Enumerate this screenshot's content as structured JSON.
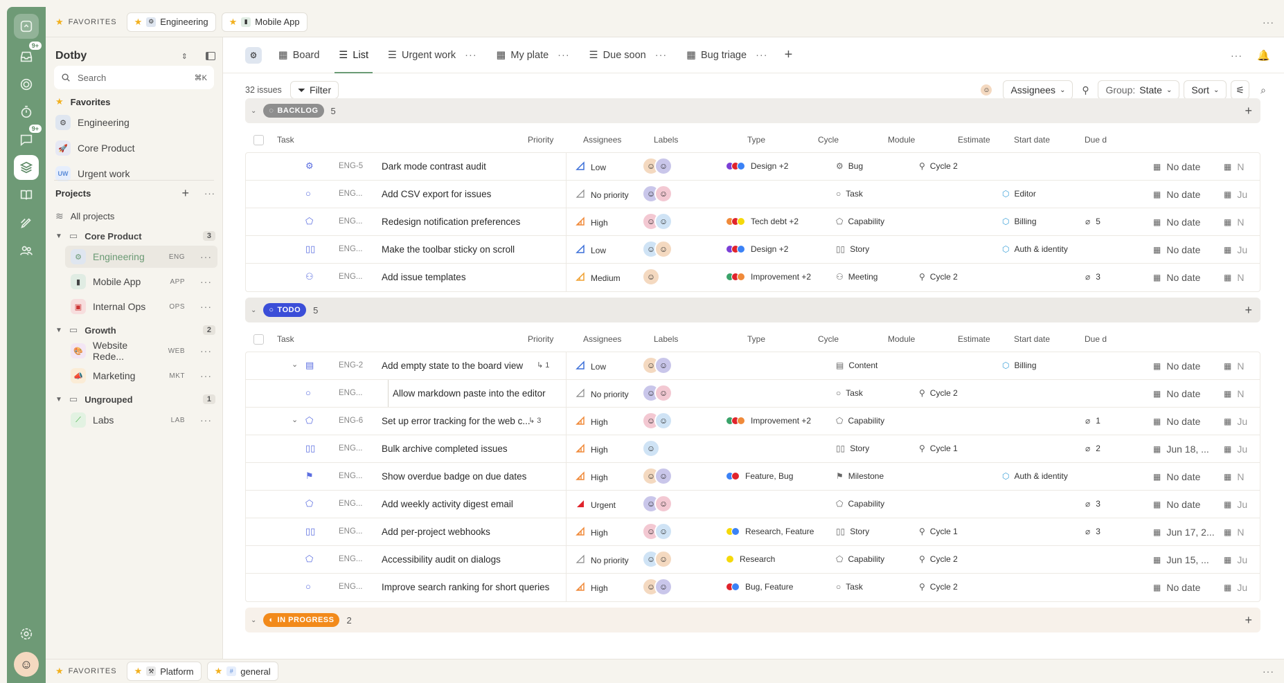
{
  "colors": {
    "accent": "#6a9a74",
    "rail": "#6e9a76",
    "backlog": "#8e8e8e",
    "todo": "#3b4ed8",
    "inprogress": "#f28a1b",
    "urgent": "#e0242c",
    "high": "#f08a3a"
  },
  "rail": {
    "badges": [
      "9+",
      "9+"
    ]
  },
  "topbar": {
    "favorites_label": "FAVORITES",
    "chips": [
      {
        "label": "Engineering",
        "icon": "gear-icon"
      },
      {
        "label": "Mobile App",
        "icon": "phone-icon"
      }
    ],
    "more": "···"
  },
  "bottombar": {
    "favorites_label": "FAVORITES",
    "chips": [
      {
        "label": "Platform",
        "icon": "tools-icon"
      },
      {
        "label": "general",
        "icon": "hash-icon"
      }
    ],
    "more": "···"
  },
  "sidebar": {
    "workspace": "Dotby",
    "search": {
      "placeholder": "Search",
      "shortcut": "⌘K"
    },
    "favorites_title": "Favorites",
    "favorites": [
      {
        "label": "Engineering"
      },
      {
        "label": "Core Product"
      },
      {
        "label": "Urgent work",
        "badge": "UW"
      }
    ],
    "projects_title": "Projects",
    "all_projects": "All projects",
    "groups": [
      {
        "label": "Core Product",
        "count": "3",
        "items": [
          {
            "label": "Engineering",
            "code": "ENG"
          },
          {
            "label": "Mobile App",
            "code": "APP"
          },
          {
            "label": "Internal Ops",
            "code": "OPS"
          }
        ]
      },
      {
        "label": "Growth",
        "count": "2",
        "items": [
          {
            "label": "Website Rede...",
            "code": "WEB"
          },
          {
            "label": "Marketing",
            "code": "MKT"
          }
        ]
      },
      {
        "label": "Ungrouped",
        "count": "1",
        "items": [
          {
            "label": "Labs",
            "code": "LAB"
          }
        ]
      }
    ]
  },
  "viewtabs": [
    {
      "label": "Board"
    },
    {
      "label": "List"
    },
    {
      "label": "Urgent work"
    },
    {
      "label": "My plate"
    },
    {
      "label": "Due soon"
    },
    {
      "label": "Bug triage"
    }
  ],
  "toolbar": {
    "count": "32 issues",
    "filter": "Filter",
    "assignees": "Assignees",
    "group_prefix": "Group:",
    "group_value": "State",
    "sort": "Sort"
  },
  "columns": {
    "task": "Task",
    "priority": "Priority",
    "assignees": "Assignees",
    "labels": "Labels",
    "type": "Type",
    "cycle": "Cycle",
    "module": "Module",
    "estimate": "Estimate",
    "start": "Start date",
    "due": "Due d"
  },
  "groups": [
    {
      "state": "BACKLOG",
      "count": "5",
      "rows": [
        {
          "id": "ENG-5",
          "title": "Dark mode contrast audit",
          "priority": "Low",
          "labels": "Design +2",
          "type": "Bug",
          "cycle": "Cycle 2",
          "module": "",
          "estimate": "",
          "start": "No date",
          "due": "N"
        },
        {
          "id": "ENG...",
          "title": "Add CSV export for issues",
          "priority": "No priority",
          "labels": "",
          "type": "Task",
          "cycle": "",
          "module": "Editor",
          "estimate": "",
          "start": "No date",
          "due": "Ju"
        },
        {
          "id": "ENG...",
          "title": "Redesign notification preferences",
          "priority": "High",
          "labels": "Tech debt +2",
          "type": "Capability",
          "cycle": "",
          "module": "Billing",
          "estimate": "5",
          "start": "No date",
          "due": "N"
        },
        {
          "id": "ENG...",
          "title": "Make the toolbar sticky on scroll",
          "priority": "Low",
          "labels": "Design +2",
          "type": "Story",
          "cycle": "",
          "module": "Auth & identity",
          "estimate": "",
          "start": "No date",
          "due": "Ju"
        },
        {
          "id": "ENG...",
          "title": "Add issue templates",
          "priority": "Medium",
          "labels": "Improvement +2",
          "type": "Meeting",
          "cycle": "Cycle 2",
          "module": "",
          "estimate": "3",
          "start": "No date",
          "due": "N"
        }
      ]
    },
    {
      "state": "TODO",
      "count": "5",
      "rows": [
        {
          "id": "ENG-2",
          "title": "Add empty state to the board view",
          "sub": "1",
          "priority": "Low",
          "labels": "",
          "type": "Content",
          "cycle": "",
          "module": "Billing",
          "estimate": "",
          "start": "No date",
          "due": "N"
        },
        {
          "id": "ENG...",
          "title": "Allow markdown paste into the editor",
          "priority": "No priority",
          "labels": "",
          "type": "Task",
          "cycle": "Cycle 2",
          "module": "",
          "estimate": "",
          "start": "No date",
          "due": "N"
        },
        {
          "id": "ENG-6",
          "title": "Set up error tracking for the web c...",
          "sub": "3",
          "priority": "High",
          "labels": "Improvement +2",
          "type": "Capability",
          "cycle": "",
          "module": "",
          "estimate": "1",
          "start": "No date",
          "due": "Ju"
        },
        {
          "id": "ENG...",
          "title": "Bulk archive completed issues",
          "priority": "High",
          "labels": "",
          "type": "Story",
          "cycle": "Cycle 1",
          "module": "",
          "estimate": "2",
          "start": "Jun 18, ...",
          "due": "Ju"
        },
        {
          "id": "ENG...",
          "title": "Show overdue badge on due dates",
          "priority": "High",
          "labels": "Feature, Bug",
          "type": "Milestone",
          "cycle": "",
          "module": "Auth & identity",
          "estimate": "",
          "start": "No date",
          "due": "N"
        },
        {
          "id": "ENG...",
          "title": "Add weekly activity digest email",
          "priority": "Urgent",
          "labels": "",
          "type": "Capability",
          "cycle": "",
          "module": "",
          "estimate": "3",
          "start": "No date",
          "due": "Ju"
        },
        {
          "id": "ENG...",
          "title": "Add per-project webhooks",
          "priority": "High",
          "labels": "Research, Feature",
          "type": "Story",
          "cycle": "Cycle 1",
          "module": "",
          "estimate": "3",
          "start": "Jun 17, 2...",
          "due": "N"
        },
        {
          "id": "ENG...",
          "title": "Accessibility audit on dialogs",
          "priority": "No priority",
          "labels": "Research",
          "type": "Capability",
          "cycle": "Cycle 2",
          "module": "",
          "estimate": "",
          "start": "Jun 15, ...",
          "due": "Ju"
        },
        {
          "id": "ENG...",
          "title": "Improve search ranking for short queries",
          "priority": "High",
          "labels": "Bug, Feature",
          "type": "Task",
          "cycle": "Cycle 2",
          "module": "",
          "estimate": "",
          "start": "No date",
          "due": "Ju"
        }
      ]
    },
    {
      "state": "IN PROGRESS",
      "count": "2",
      "rows": []
    }
  ]
}
